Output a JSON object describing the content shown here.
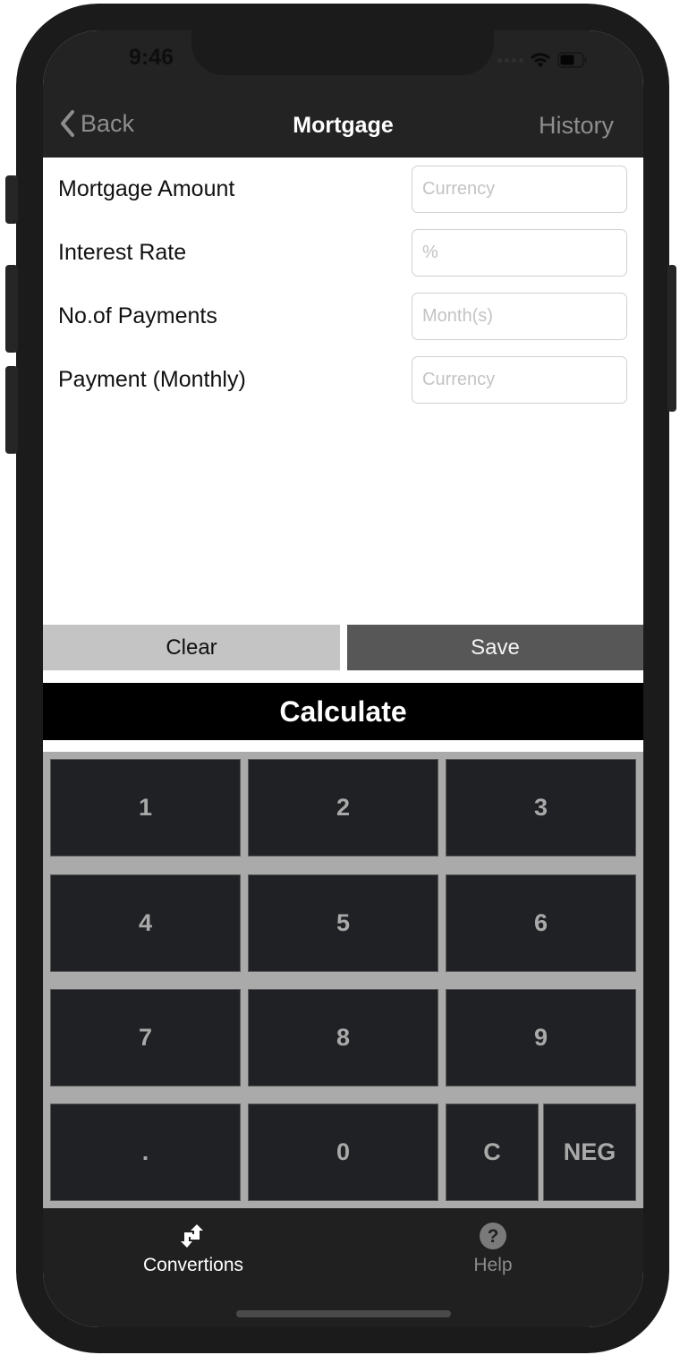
{
  "status_bar": {
    "time": "9:46"
  },
  "navbar": {
    "back_label": "Back",
    "title": "Mortgage",
    "history_label": "History"
  },
  "form": {
    "rows": [
      {
        "label": "Mortgage Amount",
        "value": "",
        "placeholder": "Currency"
      },
      {
        "label": "Interest Rate",
        "value": "",
        "placeholder": "%"
      },
      {
        "label": "No.of Payments",
        "value": "",
        "placeholder": "Month(s)"
      },
      {
        "label": "Payment (Monthly)",
        "value": "",
        "placeholder": "Currency"
      }
    ]
  },
  "actions": {
    "clear_label": "Clear",
    "save_label": "Save",
    "calculate_label": "Calculate"
  },
  "keypad": {
    "keys": [
      "1",
      "2",
      "3",
      "4",
      "5",
      "6",
      "7",
      "8",
      "9",
      ".",
      "0",
      "C",
      "NEG"
    ]
  },
  "tabbar": {
    "tabs": [
      {
        "label": "Convertions",
        "icon": "convert-arrows-icon",
        "active": true
      },
      {
        "label": "Help",
        "icon": "help-circle-icon",
        "active": false
      }
    ]
  },
  "colors": {
    "navbar_bg": "#232323",
    "clear_bg": "#c4c4c4",
    "save_bg": "#575757",
    "calculate_bg": "#000000",
    "keypad_bg": "#aaaaaa",
    "key_bg": "#202125",
    "key_text": "#a9a9a9",
    "tabbar_bg": "#202020"
  }
}
